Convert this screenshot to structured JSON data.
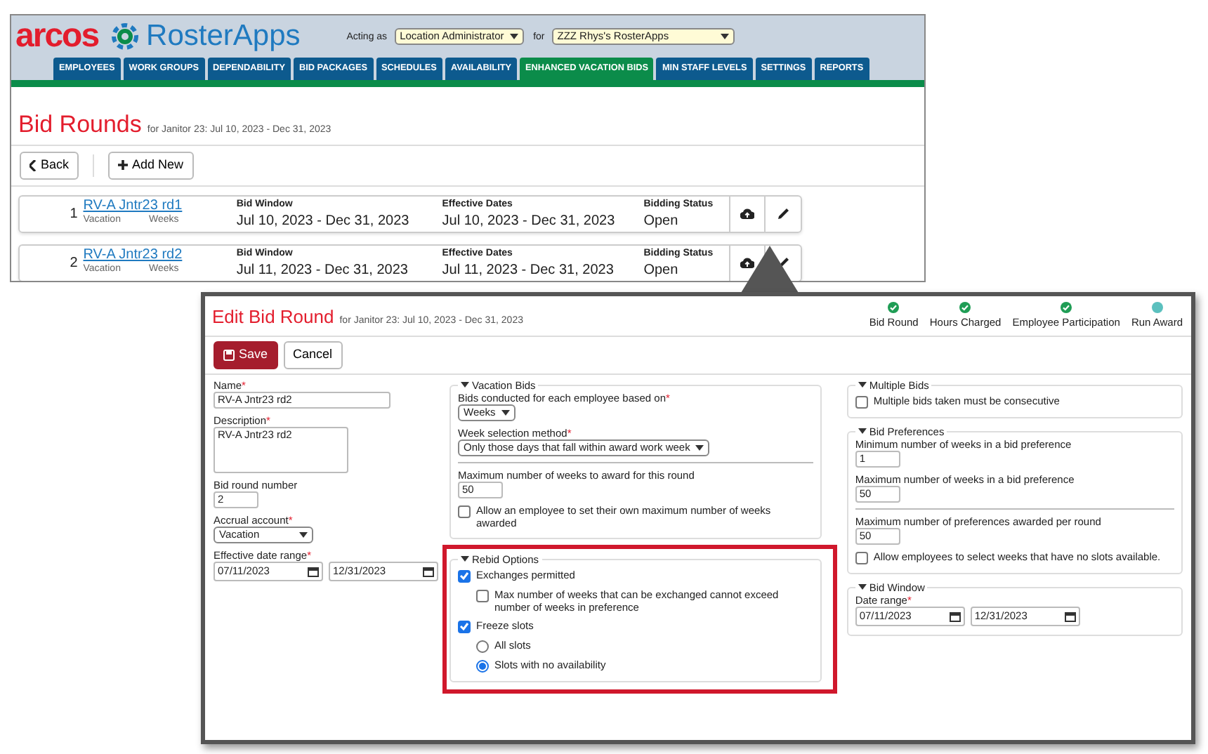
{
  "app": {
    "logo_text": "arcos",
    "brand": "RosterApps",
    "acting_as_label": "Acting as",
    "role": "Location Administrator",
    "for_label": "for",
    "organization": "ZZZ Rhys's RosterApps",
    "tabs": [
      {
        "label": "EMPLOYEES",
        "selected": false
      },
      {
        "label": "WORK GROUPS",
        "selected": false
      },
      {
        "label": "DEPENDABILITY",
        "selected": false
      },
      {
        "label": "BID PACKAGES",
        "selected": false
      },
      {
        "label": "SCHEDULES",
        "selected": false
      },
      {
        "label": "AVAILABILITY",
        "selected": false
      },
      {
        "label": "ENHANCED VACATION BIDS",
        "selected": true
      },
      {
        "label": "MIN STAFF LEVELS",
        "selected": false
      },
      {
        "label": "SETTINGS",
        "selected": false
      },
      {
        "label": "REPORTS",
        "selected": false
      }
    ]
  },
  "page": {
    "title": "Bid Rounds",
    "subtitle": "for Janitor 23: Jul 10, 2023 - Dec 31, 2023",
    "back_button": "Back",
    "add_button": "Add New",
    "rounds": [
      {
        "number": "1",
        "name": "RV-A Jntr23 rd1",
        "account": "Vacation",
        "unit": "Weeks",
        "bid_window_label": "Bid Window",
        "bid_window": "Jul 10, 2023 - Dec 31, 2023",
        "effective_label": "Effective Dates",
        "effective": "Jul 10, 2023 - Dec 31, 2023",
        "status_label": "Bidding Status",
        "status": "Open"
      },
      {
        "number": "2",
        "name": "RV-A Jntr23 rd2",
        "account": "Vacation",
        "unit": "Weeks",
        "bid_window_label": "Bid Window",
        "bid_window": "Jul 11, 2023 - Dec 31, 2023",
        "effective_label": "Effective Dates",
        "effective": "Jul 11, 2023 - Dec 31, 2023",
        "status_label": "Bidding Status",
        "status": "Open"
      }
    ]
  },
  "edit_dialog": {
    "title": "Edit Bid Round",
    "subtitle": "for Janitor 23: Jul 10, 2023 - Dec 31, 2023",
    "steps": [
      {
        "label": "Bid Round",
        "complete": true
      },
      {
        "label": "Hours Charged",
        "complete": true
      },
      {
        "label": "Employee Participation",
        "complete": true
      },
      {
        "label": "Run Award",
        "complete": false
      }
    ],
    "save_button": "Save",
    "cancel_button": "Cancel",
    "left_fields": [
      {
        "kind": "input",
        "label": "Name",
        "required_mark": "*",
        "value": "RV-A Jntr23 rd2"
      },
      {
        "kind": "textarea",
        "label": "Description",
        "required_mark": "*",
        "value": "RV-A Jntr23 rd2"
      },
      {
        "kind": "input",
        "label": "Bid round number",
        "value": "2"
      },
      {
        "kind": "select",
        "label": "Accrual account",
        "required_mark": "*",
        "value": "Vacation"
      },
      {
        "kind": "date_range",
        "label": "Effective date range",
        "required_mark": "*",
        "start": "07/11/2023",
        "end": "12/31/2023"
      }
    ],
    "middle_fieldsets": [
      {
        "legend": "Vacation Bids",
        "highlighted": false,
        "sections": [
          [
            {
              "kind": "select",
              "label": "Bids conducted for each employee based on",
              "required_mark": "*",
              "value": "Weeks"
            },
            {
              "kind": "select",
              "label": "Week selection method",
              "required_mark": "*",
              "value": "Only those days that fall within award work week"
            }
          ],
          [
            {
              "kind": "input",
              "label": "Maximum number of weeks to award for this round",
              "value": "50"
            },
            {
              "kind": "checkbox",
              "label": "Allow an employee to set their own maximum number of weeks awarded",
              "checked": false
            }
          ]
        ]
      },
      {
        "legend": "Rebid Options",
        "highlighted": true,
        "sections": [
          [
            {
              "kind": "checkbox",
              "label": "Exchanges permitted",
              "checked": true,
              "children": [
                {
                  "kind": "checkbox",
                  "label": "Max number of weeks that can be exchanged cannot exceed number of weeks in preference",
                  "checked": false
                }
              ]
            },
            {
              "kind": "checkbox",
              "label": "Freeze slots",
              "checked": true,
              "children": [
                {
                  "kind": "radio",
                  "label": "All slots",
                  "selected": false
                },
                {
                  "kind": "radio",
                  "label": "Slots with no availability",
                  "selected": true
                }
              ]
            }
          ]
        ]
      }
    ],
    "right_fieldsets": [
      {
        "legend": "Multiple Bids",
        "highlighted": false,
        "sections": [
          [
            {
              "kind": "checkbox",
              "label": "Multiple bids taken must be consecutive",
              "checked": false
            }
          ]
        ]
      },
      {
        "legend": "Bid Preferences",
        "highlighted": false,
        "sections": [
          [
            {
              "kind": "input",
              "label": "Minimum number of weeks in a bid preference",
              "value": "1"
            },
            {
              "kind": "input",
              "label": "Maximum number of weeks in a bid preference",
              "value": "50"
            }
          ],
          [
            {
              "kind": "input",
              "label": "Maximum number of preferences awarded per round",
              "value": "50"
            },
            {
              "kind": "checkbox",
              "label": "Allow employees to select weeks that have no slots available.",
              "checked": false
            }
          ]
        ]
      },
      {
        "legend": "Bid Window",
        "highlighted": false,
        "sections": [
          [
            {
              "kind": "date_range",
              "label": "Date range",
              "required_mark": "*",
              "start": "07/11/2023",
              "end": "12/31/2023"
            }
          ]
        ]
      }
    ]
  }
}
